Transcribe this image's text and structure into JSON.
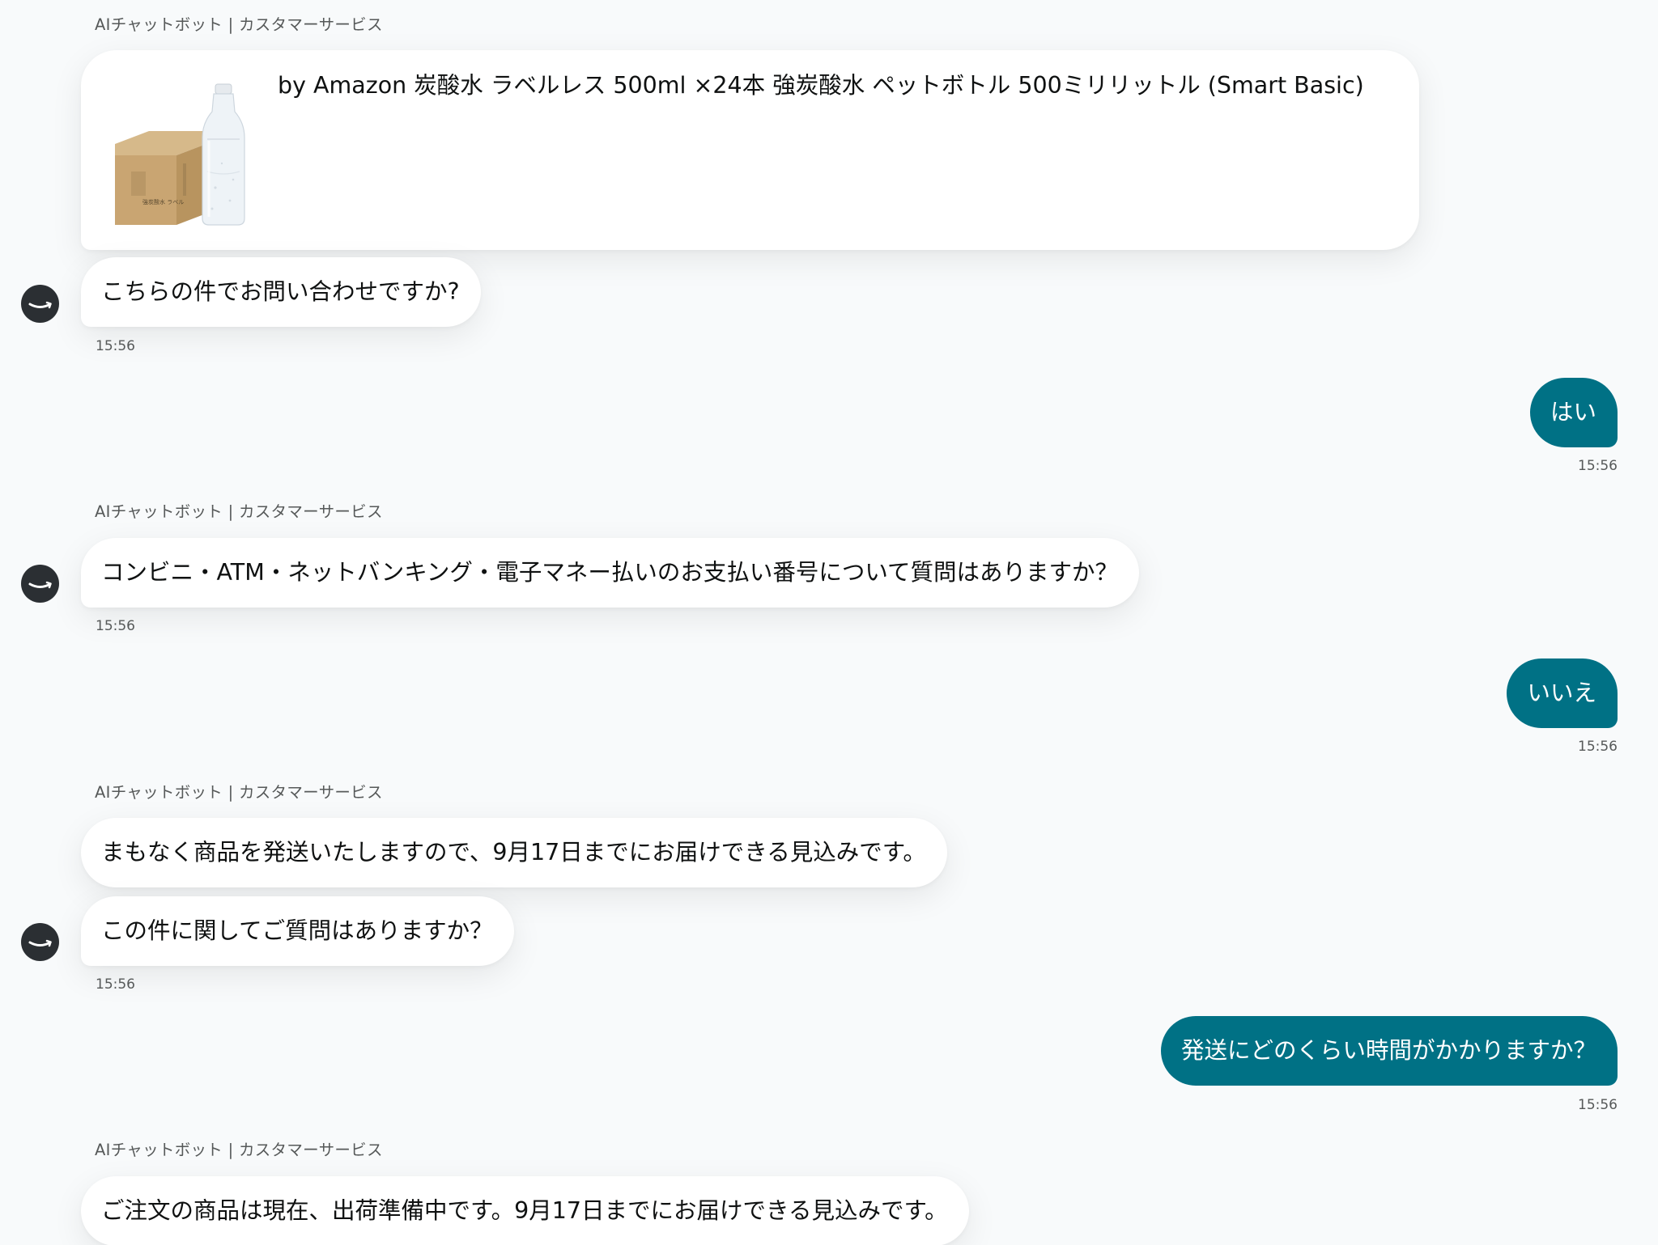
{
  "bot_sender_label": "AIチャットボット | カスタマーサービス",
  "product": {
    "title": "by Amazon 炭酸水 ラベルレス 500ml ×24本 強炭酸水 ペットボトル 500ミリリットル (Smart Basic)",
    "image_icon": "product-bottle-box-image",
    "box_text": "強炭酸水 ラベル"
  },
  "messages": [
    {
      "id": "m1",
      "from": "bot",
      "text": "こちらの件でお問い合わせですか?",
      "time": "15:56"
    },
    {
      "id": "m2",
      "from": "user",
      "text": "はい",
      "time": "15:56"
    },
    {
      "id": "m3",
      "from": "bot",
      "text": "コンビニ・ATM・ネットバンキング・電子マネー払いのお支払い番号について質問はありますか？",
      "time": "15:56"
    },
    {
      "id": "m4",
      "from": "user",
      "text": "いいえ",
      "time": "15:56"
    },
    {
      "id": "m5a",
      "from": "bot",
      "text": "まもなく商品を発送いたしますので、9月17日までにお届けできる見込みです。"
    },
    {
      "id": "m5b",
      "from": "bot",
      "text": "この件に関してご質問はありますか？",
      "time": "15:56"
    },
    {
      "id": "m6",
      "from": "user",
      "text": "発送にどのくらい時間がかかりますか？",
      "time": "15:56"
    },
    {
      "id": "m7",
      "from": "bot",
      "text": "ご注文の商品は現在、出荷準備中です。9月17日までにお届けできる見込みです。"
    }
  ],
  "colors": {
    "user_bubble": "#007185",
    "bot_bubble": "#ffffff",
    "background": "#f8fafb",
    "avatar": "#2b2f33"
  },
  "avatar_icon": "amazon-smile-icon"
}
